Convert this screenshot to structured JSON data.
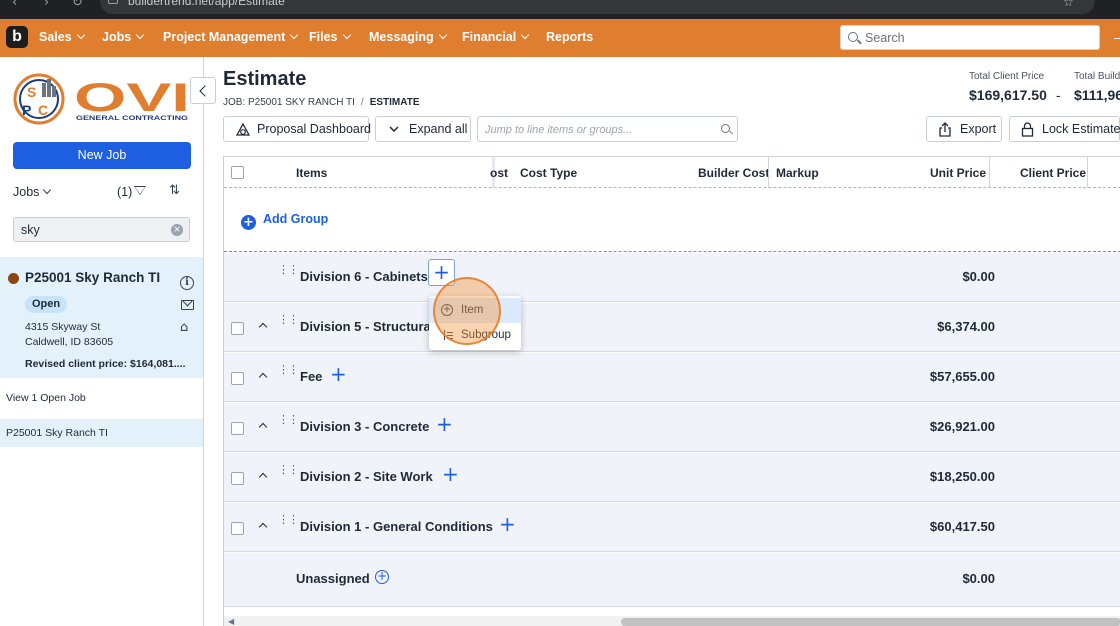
{
  "browser": {
    "url": "buildertrend.net/app/Estimate"
  },
  "topnav": {
    "logo": "b",
    "items": [
      "Sales",
      "Jobs",
      "Project Management",
      "Files",
      "Messaging",
      "Financial",
      "Reports"
    ],
    "search_placeholder": "Search",
    "brand_color": "#e07e2f"
  },
  "sidebar": {
    "company_logo_text": "OVI",
    "company_logo_sub": "GENERAL CONTRACTING",
    "company_logo_initials": [
      "S",
      "P",
      "C"
    ],
    "new_job_label": "New Job",
    "jobs_label": "Jobs",
    "filter_count": "(1)",
    "search_value": "sky",
    "job": {
      "title": "P25001 Sky Ranch TI",
      "status": "Open",
      "address_line1": "4315 Skyway St",
      "address_line2": "Caldwell, ID 83605",
      "revised_price": "Revised client price: $164,081...."
    },
    "view_open": "View 1 Open Job",
    "recent_job": "P25001 Sky Ranch TI"
  },
  "main": {
    "title": "Estimate",
    "breadcrumb": [
      "JOB: P25001 SKY RANCH TI",
      "/",
      "ESTIMATE"
    ],
    "totals": [
      {
        "label": "Total Client Price",
        "value": "$169,617.50"
      },
      {
        "label": "Total Build",
        "value": "$111,96"
      }
    ],
    "totals_separator": "-",
    "toolbar": {
      "proposal_dashboard": "Proposal Dashboard",
      "expand_all": "Expand all",
      "jump_placeholder": "Jump to line items or groups...",
      "export": "Export",
      "lock_estimate": "Lock Estimate"
    },
    "columns": [
      "Items",
      "ost",
      "Cost Type",
      "Builder Cost",
      "Markup",
      "Unit Price",
      "Client Price"
    ],
    "add_group": "Add Group",
    "rows": [
      {
        "name": "Division 6 - Cabinets",
        "amount": "$0.00"
      },
      {
        "name": "Division 5 - Structura",
        "amount": "$6,374.00"
      },
      {
        "name": "Fee",
        "amount": "$57,655.00"
      },
      {
        "name": "Division 3 - Concrete",
        "amount": "$26,921.00"
      },
      {
        "name": "Division 2 - Site Work",
        "amount": "$18,250.00"
      },
      {
        "name": "Division 1 - General Conditions",
        "amount": "$60,417.50"
      },
      {
        "name": "Unassigned",
        "amount": "$0.00"
      }
    ],
    "dropdown": [
      "Item",
      "Subgroup"
    ]
  }
}
